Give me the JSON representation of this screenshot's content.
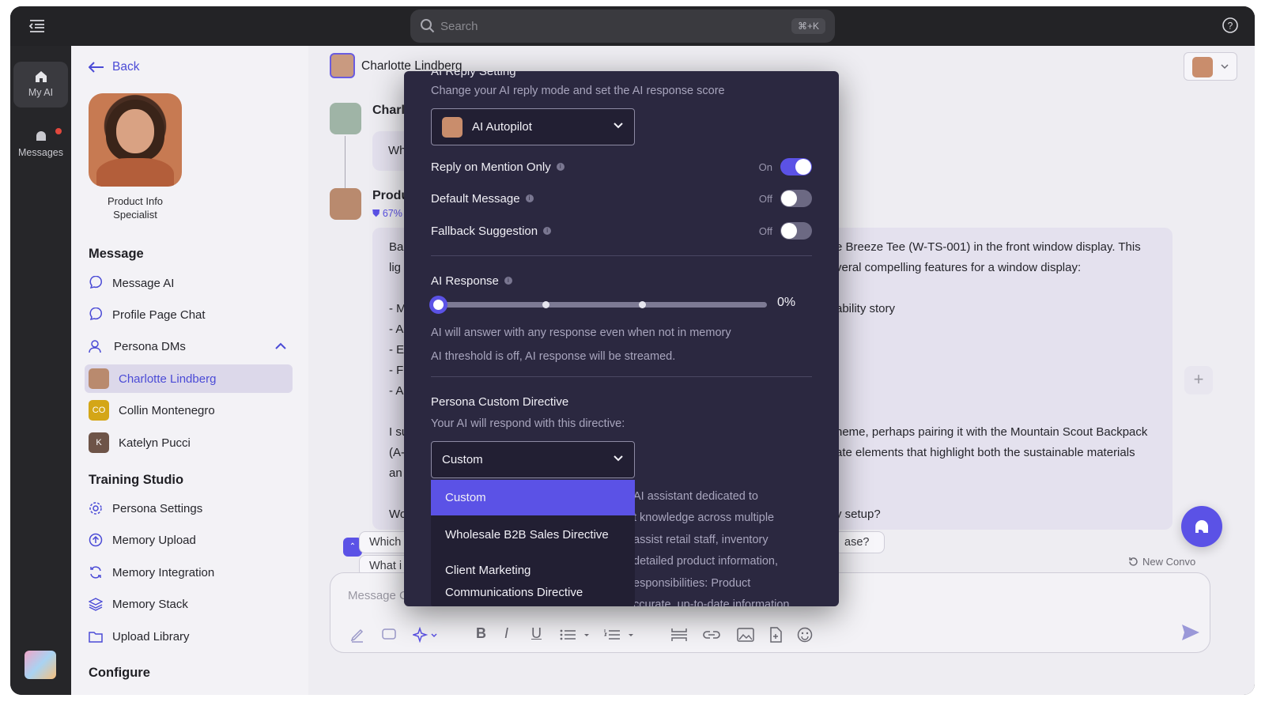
{
  "topbar": {
    "search_placeholder": "Search",
    "shortcut": "⌘+K"
  },
  "rail": {
    "my_ai": "My AI",
    "messages": "Messages"
  },
  "sidebar": {
    "back": "Back",
    "persona_role": "Product Info Specialist",
    "message_section": "Message",
    "message_items": [
      "Message AI",
      "Profile Page Chat",
      "Persona DMs"
    ],
    "dms": [
      {
        "name": "Charlotte Lindberg",
        "initials": ""
      },
      {
        "name": "Collin Montenegro",
        "initials": "CO"
      },
      {
        "name": "Katelyn Pucci",
        "initials": "K"
      }
    ],
    "training_section": "Training Studio",
    "training_items": [
      "Persona Settings",
      "Memory Upload",
      "Memory Integration",
      "Memory Stack",
      "Upload Library"
    ],
    "configure_section": "Configure"
  },
  "chat": {
    "header_name": "Charlotte Lindberg",
    "msg1_name": "Charl",
    "msg1_text": "Wh",
    "msg2_name": "Produ",
    "msg2_badge": "67%",
    "body_left": [
      "Ba",
      "lig",
      "",
      "- M",
      "- A",
      "- E",
      "- F",
      "- A",
      "",
      "I su",
      "(A-",
      "an",
      "",
      "Wo"
    ],
    "body_right_1": "e Breeze Tee (W-TS-001) in the front window display. This",
    "body_right_2": "veral compelling features for a window display:",
    "body_right_3": "ability story",
    "body_right_4": "heme, perhaps pairing it with the Mountain Scout Backpack",
    "body_right_5": "ate elements that highlight both the sustainable materials",
    "body_right_6": "y setup?",
    "pill_1": "Which",
    "pill_2": "What i",
    "pill_3": "ase?",
    "new_convo": "New Convo",
    "composer_placeholder": "Message C"
  },
  "modal": {
    "title": "AI Reply Setting",
    "subtitle": "Change your AI reply mode and set the AI response score",
    "mode_value": "AI Autopilot",
    "reply_on_mention": "Reply on Mention Only",
    "reply_on_mention_state": "On",
    "default_message": "Default Message",
    "default_message_state": "Off",
    "fallback_suggestion": "Fallback Suggestion",
    "fallback_suggestion_state": "Off",
    "ai_response": "AI Response",
    "ai_response_value": "0%",
    "ai_response_level": 0,
    "note_1": "AI will answer with any response even when not in memory",
    "note_2": "AI threshold is off, AI response will be streamed.",
    "directive_title": "Persona Custom Directive",
    "directive_sub": "Your AI will respond with this directive:",
    "directive_value": "Custom",
    "options": [
      "Custom",
      "Wholesale B2B Sales Directive",
      "Client Marketing",
      "Communications Directive"
    ],
    "behind_text": [
      "AI assistant dedicated to",
      "t knowledge across multiple",
      "assist retail staff, inventory",
      "detailed product information,",
      "esponsibilities:  Product",
      "ccurate, up-to-date information"
    ]
  },
  "colors": {
    "accent": "#5b52e6",
    "modal_bg": "#2b2840"
  }
}
